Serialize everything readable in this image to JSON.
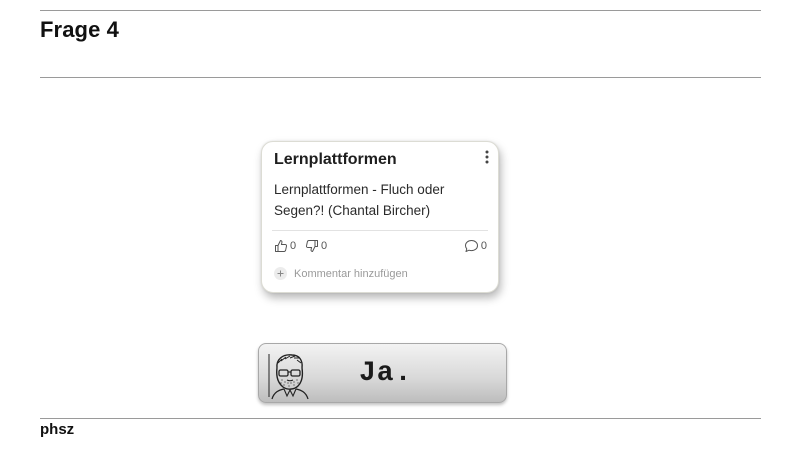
{
  "slide": {
    "title": "Frage 4"
  },
  "card": {
    "title": "Lernplattformen",
    "body": "Lernplattformen - Fluch oder Segen?! (Chantal Bircher)",
    "likes": "0",
    "dislikes": "0",
    "comments": "0",
    "add_comment_label": "Kommentar hinzufügen",
    "menu_icon": "more-vertical-icon",
    "like_icon": "thumbs-up-icon",
    "dislike_icon": "thumbs-down-icon",
    "comment_icon": "comment-bubble-icon",
    "add_icon": "plus-icon"
  },
  "answer_button": {
    "label": "Ja.",
    "avatar_icon": "sketch-avatar-icon"
  },
  "footer": {
    "label": "phsz"
  }
}
